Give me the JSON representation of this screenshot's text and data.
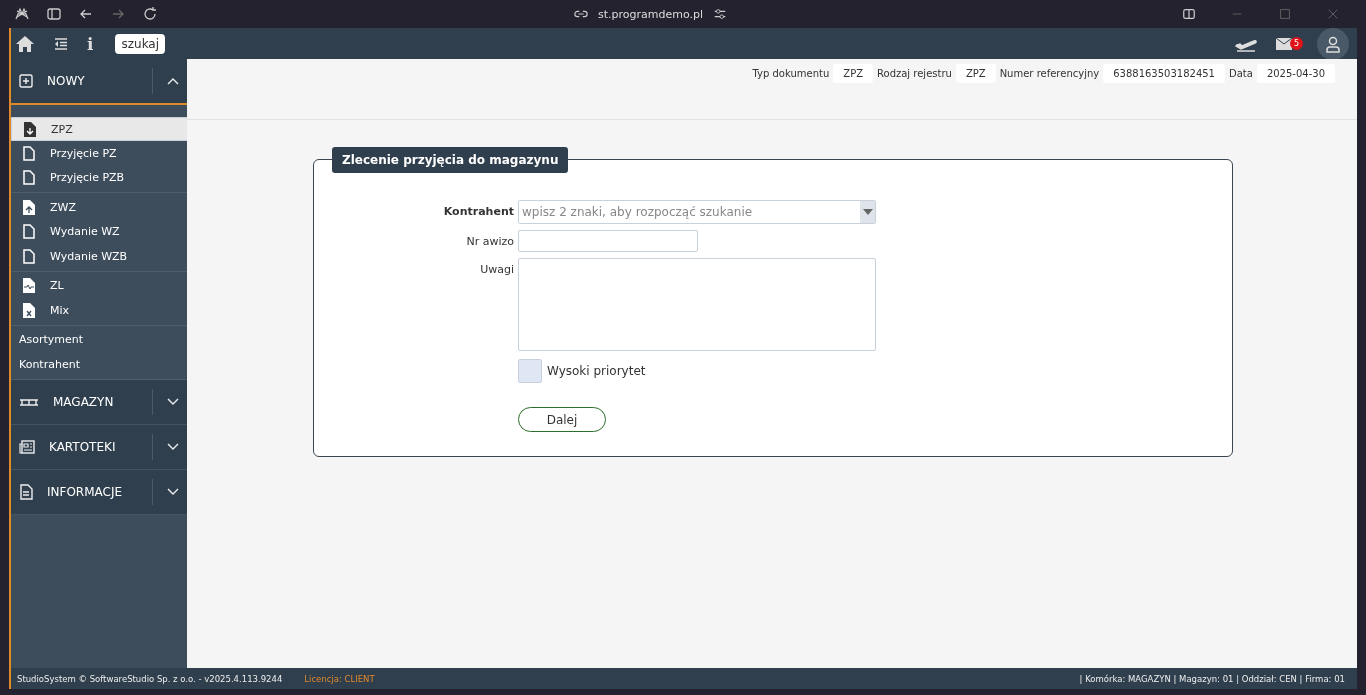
{
  "browser": {
    "url": "st.programdemo.pl"
  },
  "toolbar": {
    "info": "i",
    "search": "szukaj",
    "mail_count": "5"
  },
  "header_fields": [
    {
      "label": "Typ dokumentu",
      "value": "ZPZ"
    },
    {
      "label": "Rodzaj rejestru",
      "value": "ZPZ"
    },
    {
      "label": "Numer referencyjny",
      "value": "6388163503182451"
    },
    {
      "label": "Data",
      "value": "2025-04-30"
    }
  ],
  "sidebar": [
    {
      "label": "NOWY",
      "kind": "plus",
      "expanded": true,
      "blocks": [
        [
          {
            "label": "ZPZ",
            "kind": "download",
            "selected": true
          },
          {
            "label": "Przyjęcie PZ",
            "kind": "doc",
            "selected": false
          },
          {
            "label": "Przyjęcie PZB",
            "kind": "doc",
            "selected": false
          }
        ],
        [
          {
            "label": "ZWZ",
            "kind": "upload",
            "selected": false
          },
          {
            "label": "Wydanie WZ",
            "kind": "doc",
            "selected": false
          },
          {
            "label": "Wydanie WZB",
            "kind": "doc",
            "selected": false
          }
        ],
        [
          {
            "label": "ZL",
            "kind": "chart",
            "selected": false
          },
          {
            "label": "Mix",
            "kind": "excel",
            "selected": false
          }
        ],
        [
          {
            "label": "Asortyment",
            "kind": "plain",
            "selected": false
          },
          {
            "label": "Kontrahent",
            "kind": "plain",
            "selected": false
          }
        ]
      ]
    },
    {
      "label": "MAGAZYN",
      "kind": "pallet",
      "expanded": false
    },
    {
      "label": "KARTOTEKI",
      "kind": "cards",
      "expanded": false
    },
    {
      "label": "INFORMACJE",
      "kind": "file",
      "expanded": false
    }
  ],
  "form": {
    "title": "Zlecenie przyjęcia do magazynu",
    "fields": [
      {
        "label": "Kontrahent",
        "kind": "select",
        "placeholder": "wpisz 2 znaki, aby rozpocząć szukanie",
        "bold": true
      },
      {
        "label": "Nr awizo",
        "kind": "text",
        "bold": false
      },
      {
        "label": "Uwagi",
        "kind": "textarea",
        "bold": false
      }
    ],
    "checkbox": {
      "label": "Wysoki priorytet",
      "checked": false
    },
    "button": "Dalej"
  },
  "footer": {
    "left": "StudioSystem © SoftwareStudio Sp. z o.o. - v2025.4.113.9244",
    "license": "Licencja: CLIENT",
    "right": "| Komórka: MAGAZYN | Magazyn: 01 | Oddział: CEN | Firma: 01"
  }
}
